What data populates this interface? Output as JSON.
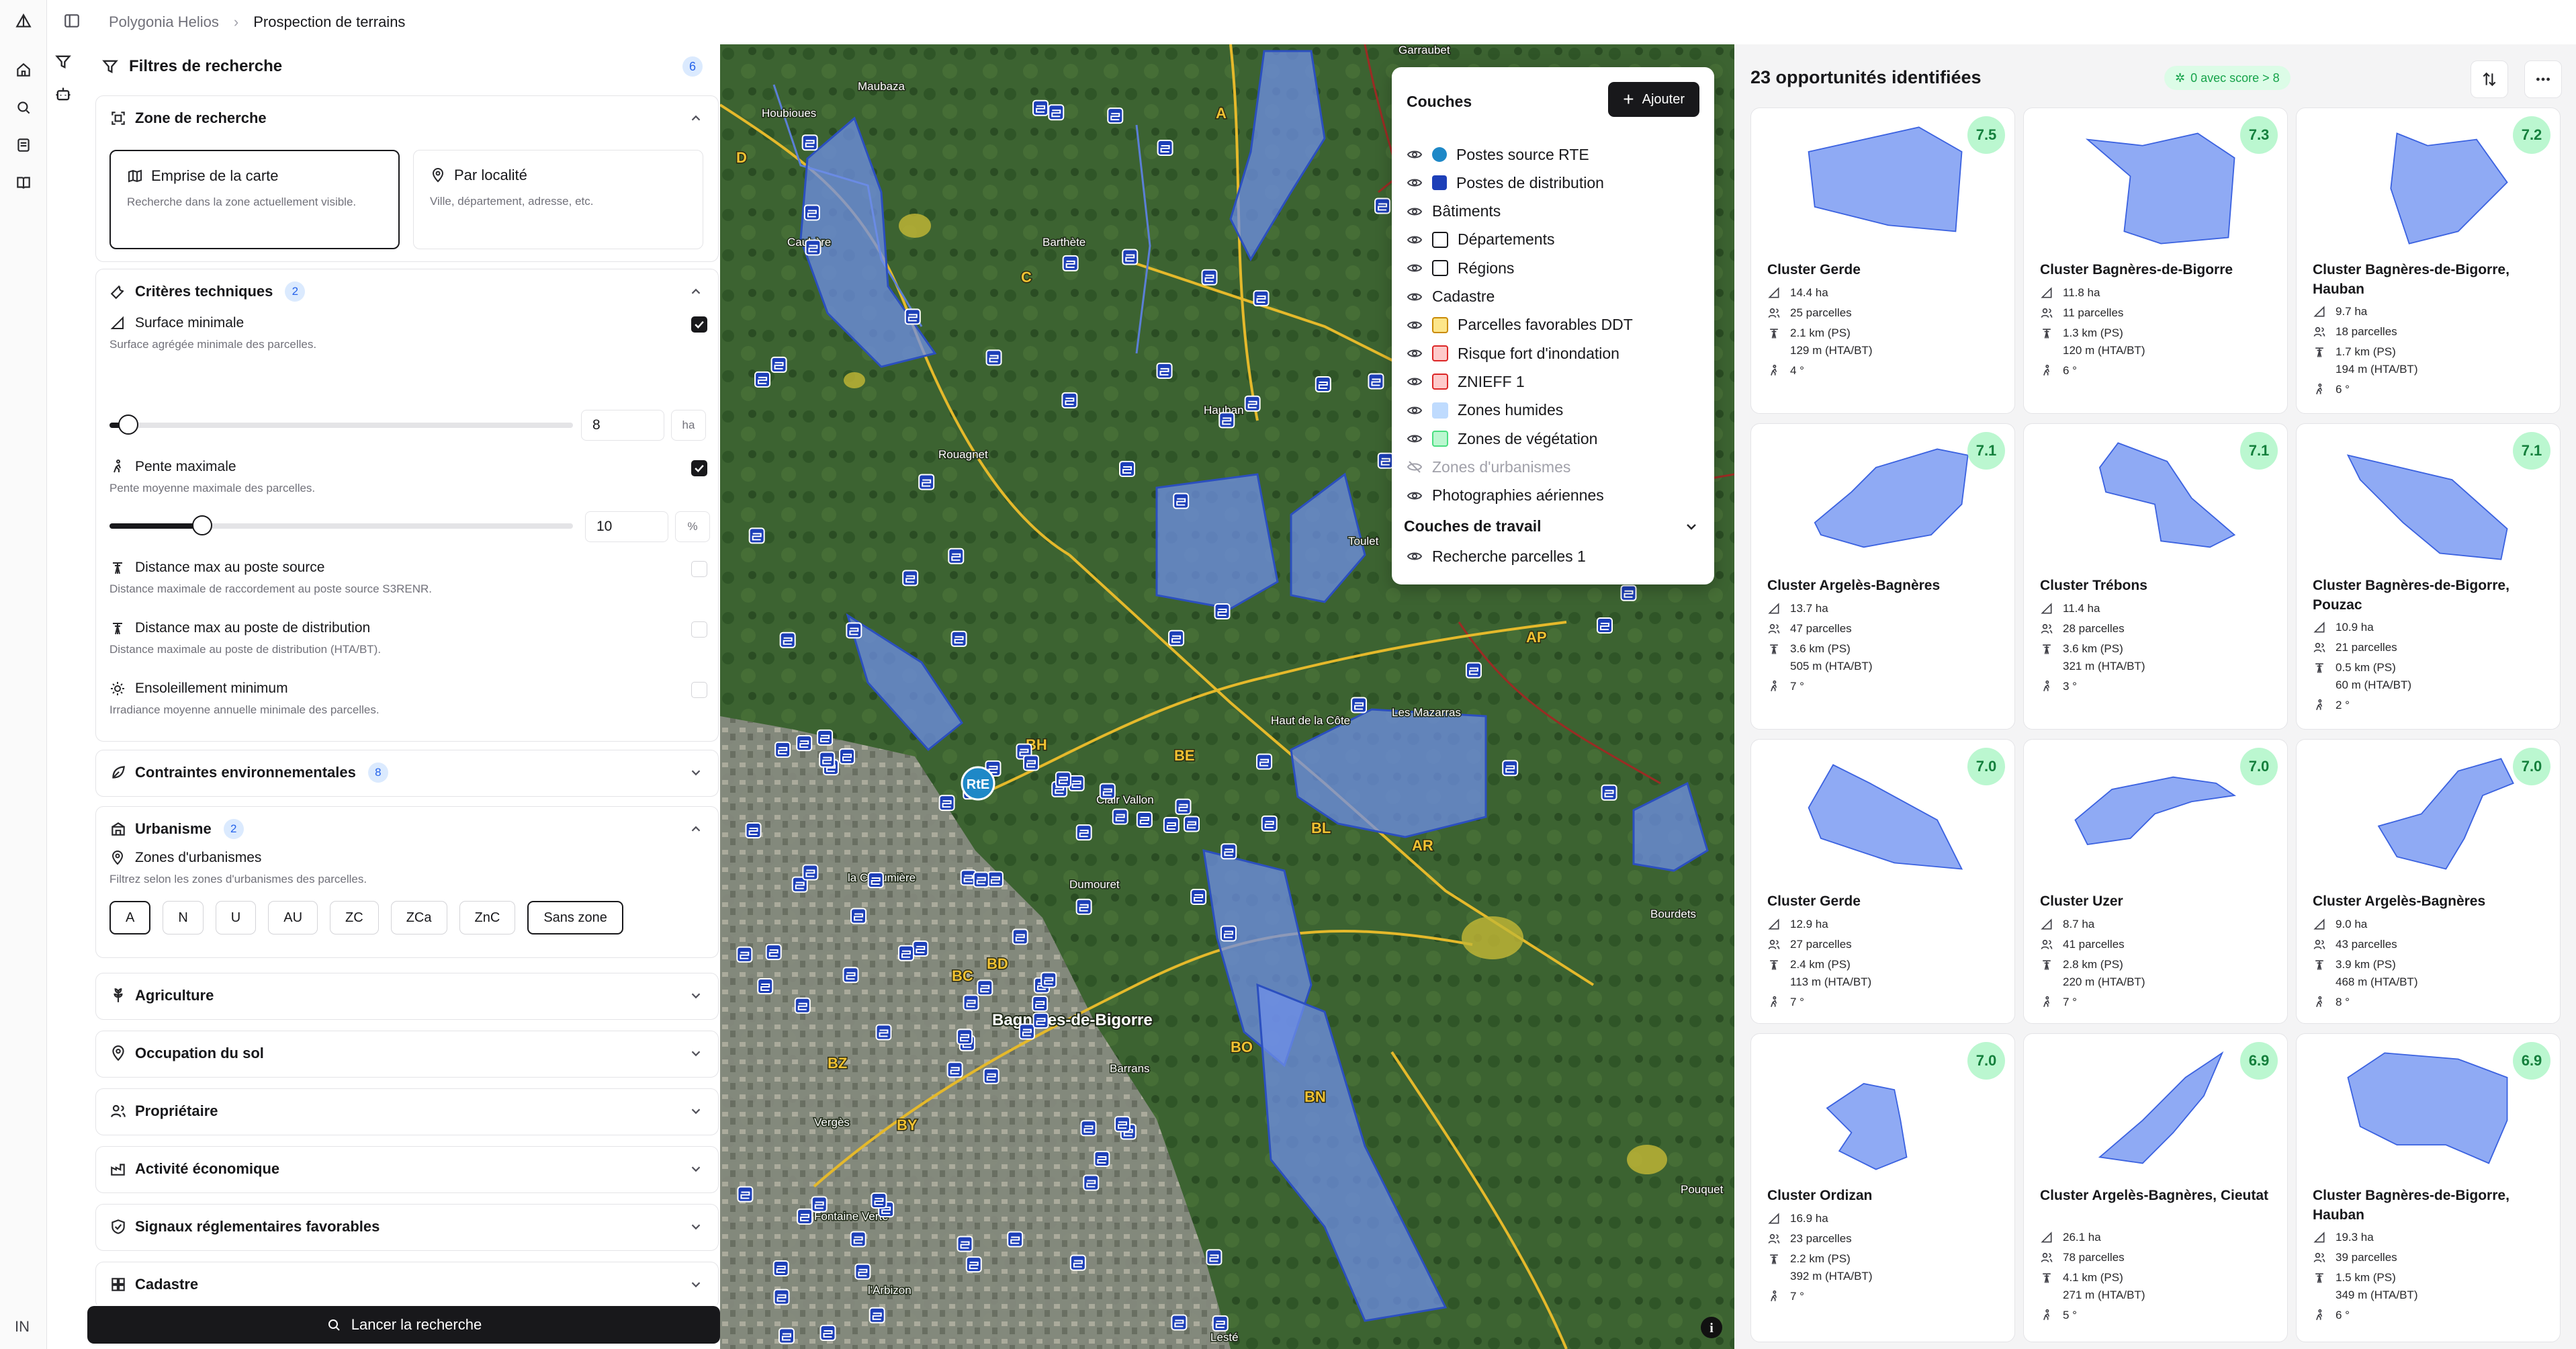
{
  "breadcrumb": {
    "app": "Polygonia Helios",
    "page": "Prospection de terrains"
  },
  "sidebar_lang": "IN",
  "filters": {
    "title": "Filtres de recherche",
    "count": "6",
    "zone": {
      "title": "Zone de recherche",
      "options": [
        {
          "label": "Emprise de la carte",
          "desc": "Recherche dans la zone actuellement visible.",
          "selected": true
        },
        {
          "label": "Par localité",
          "desc": "Ville, département, adresse, etc.",
          "selected": false
        }
      ]
    },
    "technical": {
      "title": "Critères techniques",
      "count": "2",
      "surface": {
        "label": "Surface minimale",
        "desc": "Surface agrégée minimale des parcelles.",
        "value": "8",
        "unit": "ha",
        "fraction": 0.04,
        "checked": true
      },
      "slope": {
        "label": "Pente maximale",
        "desc": "Pente moyenne maximale des parcelles.",
        "value": "10",
        "unit": "%",
        "fraction": 0.2,
        "checked": true
      },
      "dist_source": {
        "label": "Distance max au poste source",
        "desc": "Distance maximale de raccordement au poste source S3RENR.",
        "checked": false
      },
      "dist_distrib": {
        "label": "Distance max au poste de distribution",
        "desc": "Distance maximale au poste de distribution (HTA/BT).",
        "checked": false
      },
      "sun": {
        "label": "Ensoleillement minimum",
        "desc": "Irradiance moyenne annuelle minimale des parcelles.",
        "checked": false
      }
    },
    "env": {
      "title": "Contraintes environnementales",
      "count": "8"
    },
    "urbanism": {
      "title": "Urbanisme",
      "count": "2",
      "zones_label": "Zones d'urbanismes",
      "zones_desc": "Filtrez selon les zones d'urbanismes des parcelles.",
      "chips": [
        "A",
        "N",
        "U",
        "AU",
        "ZC",
        "ZCa",
        "ZnC",
        "Sans zone"
      ]
    },
    "sections": [
      "Agriculture",
      "Occupation du sol",
      "Propriétaire",
      "Activité économique",
      "Signaux réglementaires favorables",
      "Cadastre"
    ],
    "launch": "Lancer la recherche"
  },
  "map": {
    "labels": [
      "Garraubet",
      "Maubaza",
      "Houbioues",
      "Caubère",
      "Barthète",
      "Rouagnet",
      "Hauban",
      "Toulet",
      "Haut de la Côte",
      "Les Mazarras",
      "Clair Vallon",
      "la Chaumière",
      "Dumouret",
      "Bourdets",
      "Bagnères-de-Bigorre",
      "Barrans",
      "Vergès",
      "Pouquet",
      "Fontaine Verte",
      "l'Arbizon",
      "Lesté"
    ],
    "zone_codes": [
      "A",
      "D",
      "C",
      "BH",
      "BE",
      "BL",
      "AR",
      "AP",
      "BC",
      "BD",
      "BZ",
      "BY",
      "BO",
      "BN"
    ],
    "station_label": "RtE"
  },
  "layers": {
    "title": "Couches",
    "add": "Ajouter",
    "items": [
      {
        "label": "Postes source RTE",
        "swatch": "rte",
        "visible": true
      },
      {
        "label": "Postes de distribution",
        "swatch": "distrib",
        "visible": true
      },
      {
        "label": "Bâtiments",
        "swatch": "",
        "visible": true
      },
      {
        "label": "Départements",
        "swatch": "#ffffff",
        "border": "#18181b",
        "visible": true
      },
      {
        "label": "Régions",
        "swatch": "#ffffff",
        "border": "#18181b",
        "visible": true
      },
      {
        "label": "Cadastre",
        "swatch": "",
        "visible": true
      },
      {
        "label": "Parcelles favorables DDT",
        "swatch": "#fde68a",
        "border": "#ca8a04",
        "visible": true
      },
      {
        "label": "Risque fort d'inondation",
        "swatch": "#fecaca",
        "border": "#dc2626",
        "visible": true
      },
      {
        "label": "ZNIEFF 1",
        "swatch": "#fecaca",
        "border": "#dc2626",
        "visible": true
      },
      {
        "label": "Zones humides",
        "swatch": "#bfdbfe",
        "border": "#bfdbfe",
        "visible": true
      },
      {
        "label": "Zones de végétation",
        "swatch": "#bbf7d0",
        "border": "#4ade80",
        "visible": true
      },
      {
        "label": "Zones d'urbanismes",
        "swatch": "",
        "visible": false
      },
      {
        "label": "Photographies aériennes",
        "swatch": "",
        "visible": true
      }
    ],
    "work_title": "Couches de travail",
    "work_items": [
      {
        "label": "Recherche parcelles 1",
        "visible": true
      }
    ]
  },
  "results": {
    "title": "23 opportunités identifiées",
    "pill": "0 avec score > 8",
    "cards": [
      {
        "score": "7.5",
        "name": "Cluster Gerde",
        "area": "14.4 ha",
        "parcels": "25 parcelles",
        "dist": [
          "2.1 km (PS)",
          "129 m (HTA/BT)"
        ],
        "slope": "4 °"
      },
      {
        "score": "7.3",
        "name": "Cluster Bagnères-de-Bigorre",
        "area": "11.8 ha",
        "parcels": "11 parcelles",
        "dist": [
          "1.3 km (PS)",
          "120 m (HTA/BT)"
        ],
        "slope": "6 °"
      },
      {
        "score": "7.2",
        "name": "Cluster Bagnères-de-Bigorre, Hauban",
        "area": "9.7 ha",
        "parcels": "18 parcelles",
        "dist": [
          "1.7 km (PS)",
          "194 m (HTA/BT)"
        ],
        "slope": "6 °"
      },
      {
        "score": "7.1",
        "name": "Cluster Argelès-Bagnères",
        "area": "13.7 ha",
        "parcels": "47 parcelles",
        "dist": [
          "3.6 km (PS)",
          "505 m (HTA/BT)"
        ],
        "slope": "7 °"
      },
      {
        "score": "7.1",
        "name": "Cluster Trébons",
        "area": "11.4 ha",
        "parcels": "28 parcelles",
        "dist": [
          "3.6 km (PS)",
          "321 m (HTA/BT)"
        ],
        "slope": "3 °"
      },
      {
        "score": "7.1",
        "name": "Cluster Bagnères-de-Bigorre, Pouzac",
        "area": "10.9 ha",
        "parcels": "21 parcelles",
        "dist": [
          "0.5 km (PS)",
          "60 m (HTA/BT)"
        ],
        "slope": "2 °"
      },
      {
        "score": "7.0",
        "name": "Cluster Gerde",
        "area": "12.9 ha",
        "parcels": "27 parcelles",
        "dist": [
          "2.4 km (PS)",
          "113 m (HTA/BT)"
        ],
        "slope": "7 °"
      },
      {
        "score": "7.0",
        "name": "Cluster Uzer",
        "area": "8.7 ha",
        "parcels": "41 parcelles",
        "dist": [
          "2.8 km (PS)",
          "220 m (HTA/BT)"
        ],
        "slope": "7 °"
      },
      {
        "score": "7.0",
        "name": "Cluster Argelès-Bagnères",
        "area": "9.0 ha",
        "parcels": "43 parcelles",
        "dist": [
          "3.9 km (PS)",
          "468 m (HTA/BT)"
        ],
        "slope": "8 °"
      },
      {
        "score": "7.0",
        "name": "Cluster Ordizan",
        "area": "16.9 ha",
        "parcels": "23 parcelles",
        "dist": [
          "2.2 km (PS)",
          "392 m (HTA/BT)"
        ],
        "slope": "7 °"
      },
      {
        "score": "6.9",
        "name": "Cluster Argelès-Bagnères, Cieutat",
        "area": "26.1 ha",
        "parcels": "78 parcelles",
        "dist": [
          "4.1 km (PS)",
          "271 m (HTA/BT)"
        ],
        "slope": "5 °"
      },
      {
        "score": "6.9",
        "name": "Cluster Bagnères-de-Bigorre, Hauban",
        "area": "19.3 ha",
        "parcels": "39 parcelles",
        "dist": [
          "1.5 km (PS)",
          "349 m (HTA/BT)"
        ],
        "slope": "6 °"
      }
    ]
  }
}
